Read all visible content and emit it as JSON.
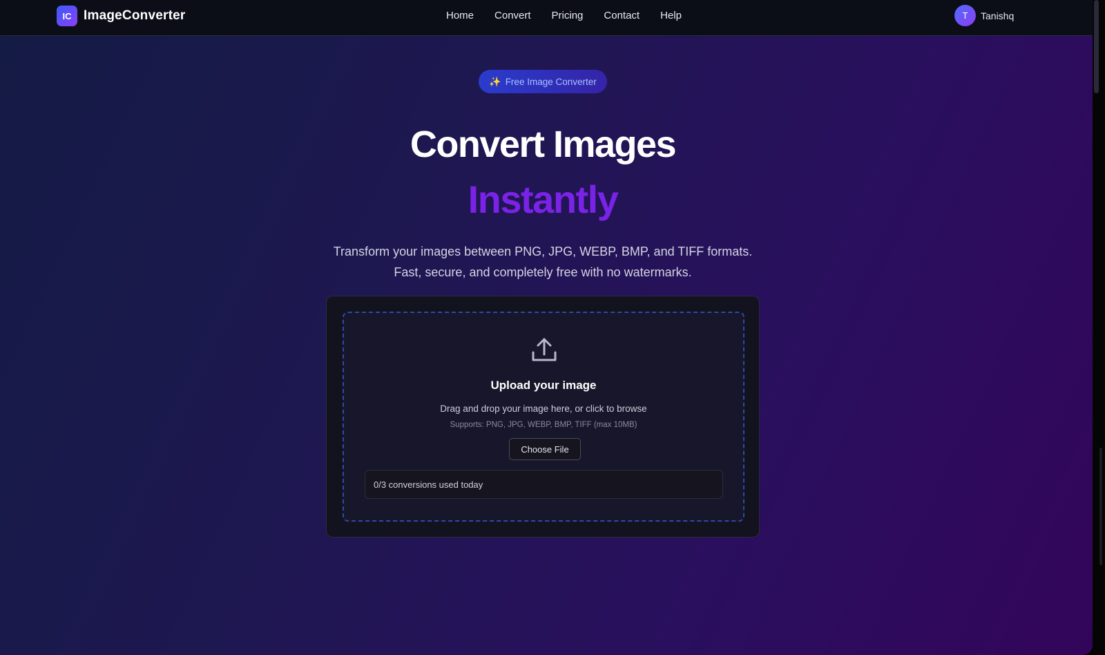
{
  "navbar": {
    "logo_text": "IC",
    "brand": "ImageConverter",
    "links": [
      "Home",
      "Convert",
      "Pricing",
      "Contact",
      "Help"
    ],
    "user": {
      "initial": "T",
      "name": "Tanishq"
    }
  },
  "hero": {
    "badge_icon": "✨",
    "badge_text": "Free Image Converter",
    "title_line1": "Convert Images",
    "title_line2": "Instantly",
    "subtitle_line1": "Transform your images between PNG, JPG, WEBP, BMP, and TIFF formats.",
    "subtitle_line2": "Fast, secure, and completely free with no watermarks."
  },
  "upload": {
    "icon": "upload-icon",
    "title": "Upload your image",
    "description": "Drag and drop your image here, or click to browse",
    "supports": "Supports: PNG, JPG, WEBP, BMP, TIFF (max 10MB)",
    "button_label": "Choose File",
    "usage_text": "0/3 conversions used today"
  },
  "colors": {
    "accent_purple": "#7a22e6",
    "badge_text": "#a9c2ff",
    "dropzone_border": "#2f4aa6"
  }
}
